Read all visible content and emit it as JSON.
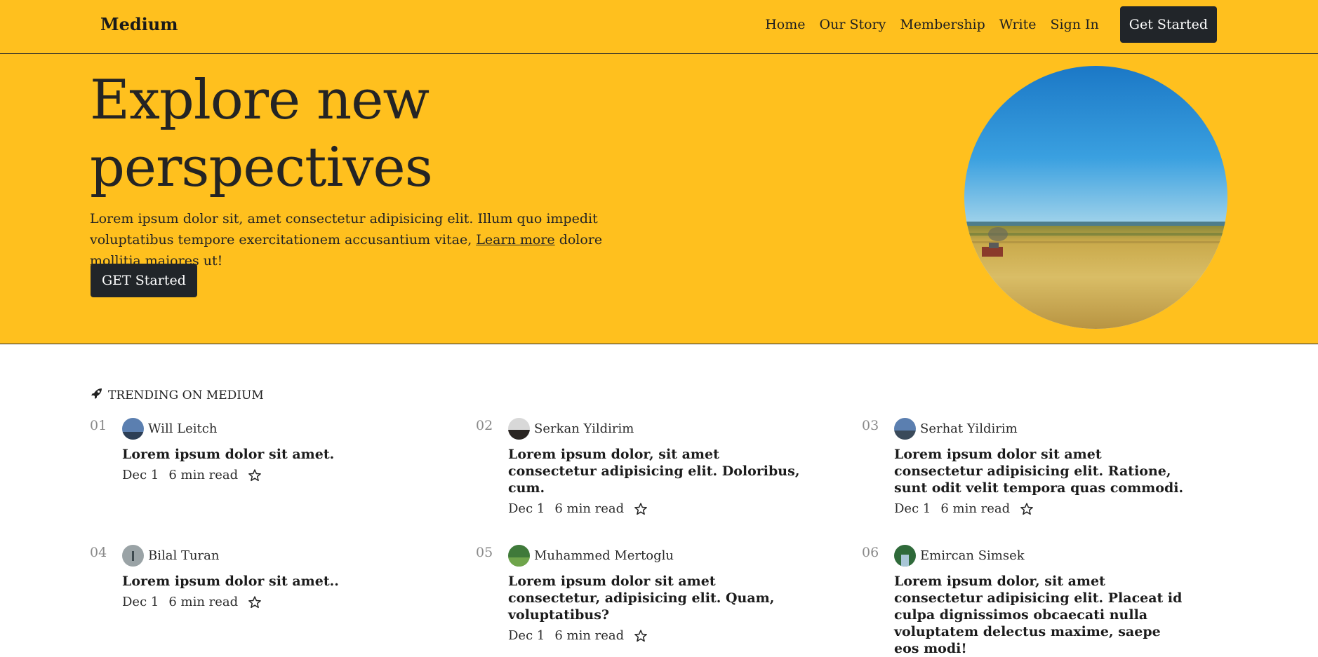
{
  "navbar": {
    "brand": "Medium",
    "links": [
      "Home",
      "Our Story",
      "Membership",
      "Write",
      "Sign In"
    ],
    "cta": "Get Started"
  },
  "hero": {
    "title": "Explore new perspectives",
    "text_before": "Lorem ipsum dolor sit, amet consectetur adipisicing elit. Illum quo impedit voluptatibus tempore exercitationem accusantium vitae,",
    "link": "Learn more",
    "text_after": "dolore mollitia maiores ut!",
    "button": "GET Started"
  },
  "trending": {
    "heading": "TRENDING ON MEDIUM",
    "items": [
      {
        "num": "01",
        "author": "Will Leitch",
        "title": "Lorem ipsum dolor sit amet.",
        "date": "Dec 1",
        "read": "6 min read"
      },
      {
        "num": "02",
        "author": "Serkan Yildirim",
        "title": "Lorem ipsum dolor, sit amet consectetur adipisicing elit. Doloribus, cum.",
        "date": "Dec 1",
        "read": "6 min read"
      },
      {
        "num": "03",
        "author": "Serhat Yildirim",
        "title": "Lorem ipsum dolor sit amet consectetur adipisicing elit. Ratione, sunt odit velit tempora quas commodi.",
        "date": "Dec 1",
        "read": "6 min read"
      },
      {
        "num": "04",
        "author": "Bilal Turan",
        "title": "Lorem ipsum dolor sit amet..",
        "date": "Dec 1",
        "read": "6 min read"
      },
      {
        "num": "05",
        "author": "Muhammed Mertoglu",
        "title": "Lorem ipsum dolor sit amet consectetur, adipisicing elit. Quam, voluptatibus?",
        "date": "Dec 1",
        "read": "6 min read"
      },
      {
        "num": "06",
        "author": "Emircan Simsek",
        "title": "Lorem ipsum dolor, sit amet consectetur adipisicing elit. Placeat id culpa dignissimos obcaecati nulla voluptatem delectus maxime, saepe eos modi!",
        "date": "",
        "read": ""
      }
    ]
  },
  "colors": {
    "accent": "#FFC01E",
    "dark": "#212529"
  }
}
